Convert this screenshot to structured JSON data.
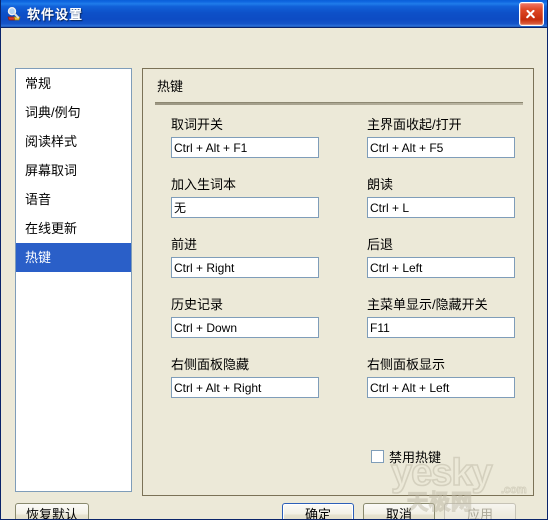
{
  "window": {
    "title": "软件设置",
    "icon": "dictionary-app-icon",
    "close_label": "×"
  },
  "sidebar": {
    "items": [
      {
        "label": "常规",
        "selected": false
      },
      {
        "label": "词典/例句",
        "selected": false
      },
      {
        "label": "阅读样式",
        "selected": false
      },
      {
        "label": "屏幕取词",
        "selected": false
      },
      {
        "label": "语音",
        "selected": false
      },
      {
        "label": "在线更新",
        "selected": false
      },
      {
        "label": "热键",
        "selected": true
      }
    ]
  },
  "panel": {
    "group_title": "热键",
    "fields": [
      {
        "label": "取词开关",
        "value": "Ctrl + Alt + F1",
        "col": 0,
        "row": 0
      },
      {
        "label": "主界面收起/打开",
        "value": "Ctrl + Alt + F5",
        "col": 1,
        "row": 0
      },
      {
        "label": "加入生词本",
        "value": "无",
        "col": 0,
        "row": 1
      },
      {
        "label": "朗读",
        "value": "Ctrl + L",
        "col": 1,
        "row": 1
      },
      {
        "label": "前进",
        "value": "Ctrl + Right",
        "col": 0,
        "row": 2
      },
      {
        "label": "后退",
        "value": "Ctrl + Left",
        "col": 1,
        "row": 2
      },
      {
        "label": "历史记录",
        "value": "Ctrl + Down",
        "col": 0,
        "row": 3
      },
      {
        "label": "主菜单显示/隐藏开关",
        "value": "F11",
        "col": 1,
        "row": 3
      },
      {
        "label": "右侧面板隐藏",
        "value": "Ctrl + Alt + Right",
        "col": 0,
        "row": 4
      },
      {
        "label": "右侧面板显示",
        "value": "Ctrl + Alt + Left",
        "col": 1,
        "row": 4
      }
    ],
    "checkbox": {
      "label": "禁用热键",
      "checked": false
    }
  },
  "buttons": {
    "restore_defaults": "恢复默认",
    "ok": "确定",
    "cancel": "取消",
    "apply": "应用"
  },
  "watermark": {
    "brand": "yesky",
    "suffix": ".com",
    "subtitle": "天极网"
  },
  "colors": {
    "titlebar_blue": "#0d50c8",
    "window_face": "#ece9d8",
    "selection_blue": "#2a5fc8",
    "input_border": "#7f9db9",
    "group_border": "#7b7257"
  }
}
